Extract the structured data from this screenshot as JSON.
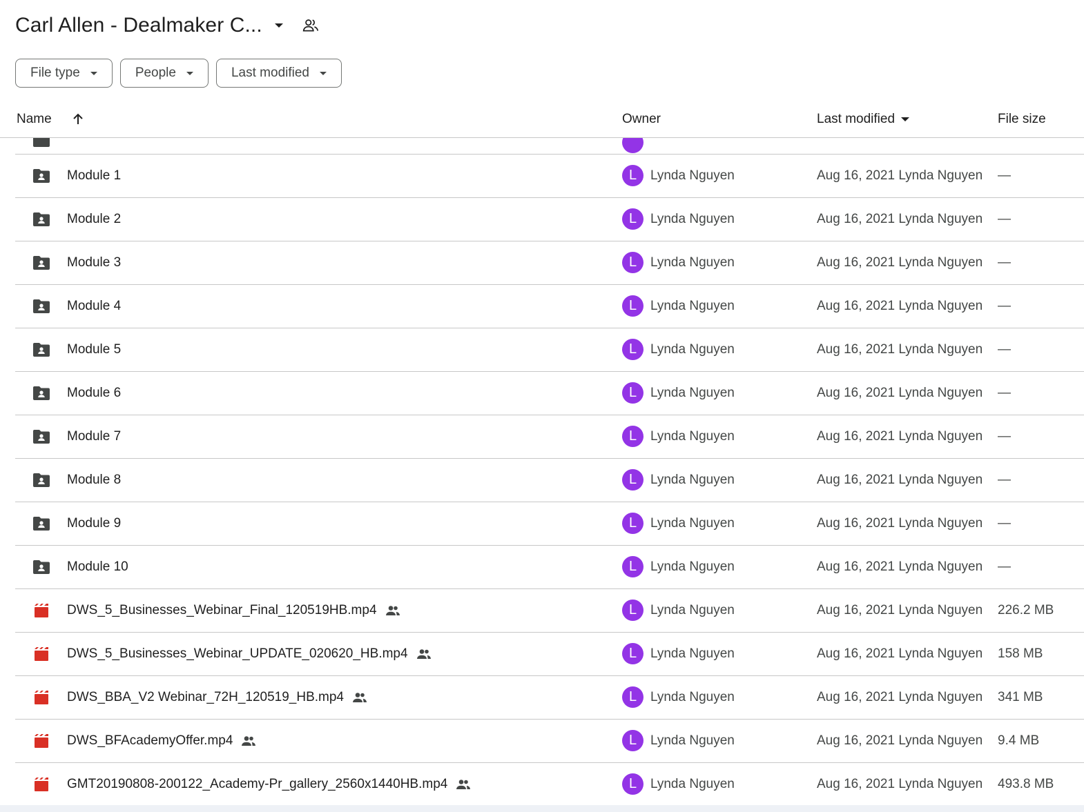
{
  "header": {
    "title": "Carl Allen - Dealmaker C...",
    "caret_icon": "arrow-drop-down-icon",
    "share_icon": "shared-people-icon"
  },
  "filters": [
    {
      "label": "File type"
    },
    {
      "label": "People"
    },
    {
      "label": "Last modified"
    }
  ],
  "columns": {
    "name": "Name",
    "owner": "Owner",
    "last_modified": "Last modified",
    "file_size": "File size"
  },
  "colors": {
    "avatar": "#9334e6",
    "video_icon": "#d93025",
    "folder_icon": "#444746"
  },
  "rows": [
    {
      "type": "folder",
      "name": "Module 1",
      "owner_initial": "L",
      "owner": "Lynda Nguyen",
      "modified": "Aug 16, 2021 Lynda Nguyen",
      "size": "—"
    },
    {
      "type": "folder",
      "name": "Module 2",
      "owner_initial": "L",
      "owner": "Lynda Nguyen",
      "modified": "Aug 16, 2021 Lynda Nguyen",
      "size": "—"
    },
    {
      "type": "folder",
      "name": "Module 3",
      "owner_initial": "L",
      "owner": "Lynda Nguyen",
      "modified": "Aug 16, 2021 Lynda Nguyen",
      "size": "—"
    },
    {
      "type": "folder",
      "name": "Module 4",
      "owner_initial": "L",
      "owner": "Lynda Nguyen",
      "modified": "Aug 16, 2021 Lynda Nguyen",
      "size": "—"
    },
    {
      "type": "folder",
      "name": "Module 5",
      "owner_initial": "L",
      "owner": "Lynda Nguyen",
      "modified": "Aug 16, 2021 Lynda Nguyen",
      "size": "—"
    },
    {
      "type": "folder",
      "name": "Module 6",
      "owner_initial": "L",
      "owner": "Lynda Nguyen",
      "modified": "Aug 16, 2021 Lynda Nguyen",
      "size": "—"
    },
    {
      "type": "folder",
      "name": "Module 7",
      "owner_initial": "L",
      "owner": "Lynda Nguyen",
      "modified": "Aug 16, 2021 Lynda Nguyen",
      "size": "—"
    },
    {
      "type": "folder",
      "name": "Module 8",
      "owner_initial": "L",
      "owner": "Lynda Nguyen",
      "modified": "Aug 16, 2021 Lynda Nguyen",
      "size": "—"
    },
    {
      "type": "folder",
      "name": "Module 9",
      "owner_initial": "L",
      "owner": "Lynda Nguyen",
      "modified": "Aug 16, 2021 Lynda Nguyen",
      "size": "—"
    },
    {
      "type": "folder",
      "name": "Module 10",
      "owner_initial": "L",
      "owner": "Lynda Nguyen",
      "modified": "Aug 16, 2021 Lynda Nguyen",
      "size": "—"
    },
    {
      "type": "video",
      "name": "DWS_5_Businesses_Webinar_Final_120519HB.mp4",
      "shared": true,
      "owner_initial": "L",
      "owner": "Lynda Nguyen",
      "modified": "Aug 16, 2021 Lynda Nguyen",
      "size": "226.2 MB"
    },
    {
      "type": "video",
      "name": "DWS_5_Businesses_Webinar_UPDATE_020620_HB.mp4",
      "shared": true,
      "owner_initial": "L",
      "owner": "Lynda Nguyen",
      "modified": "Aug 16, 2021 Lynda Nguyen",
      "size": "158 MB"
    },
    {
      "type": "video",
      "name": "DWS_BBA_V2 Webinar_72H_120519_HB.mp4",
      "shared": true,
      "owner_initial": "L",
      "owner": "Lynda Nguyen",
      "modified": "Aug 16, 2021 Lynda Nguyen",
      "size": "341 MB"
    },
    {
      "type": "video",
      "name": "DWS_BFAcademyOffer.mp4",
      "shared": true,
      "owner_initial": "L",
      "owner": "Lynda Nguyen",
      "modified": "Aug 16, 2021 Lynda Nguyen",
      "size": "9.4 MB"
    },
    {
      "type": "video",
      "name": "GMT20190808-200122_Academy-Pr_gallery_2560x1440HB.mp4",
      "shared": true,
      "owner_initial": "L",
      "owner": "Lynda Nguyen",
      "modified": "Aug 16, 2021 Lynda Nguyen",
      "size": "493.8 MB"
    }
  ]
}
